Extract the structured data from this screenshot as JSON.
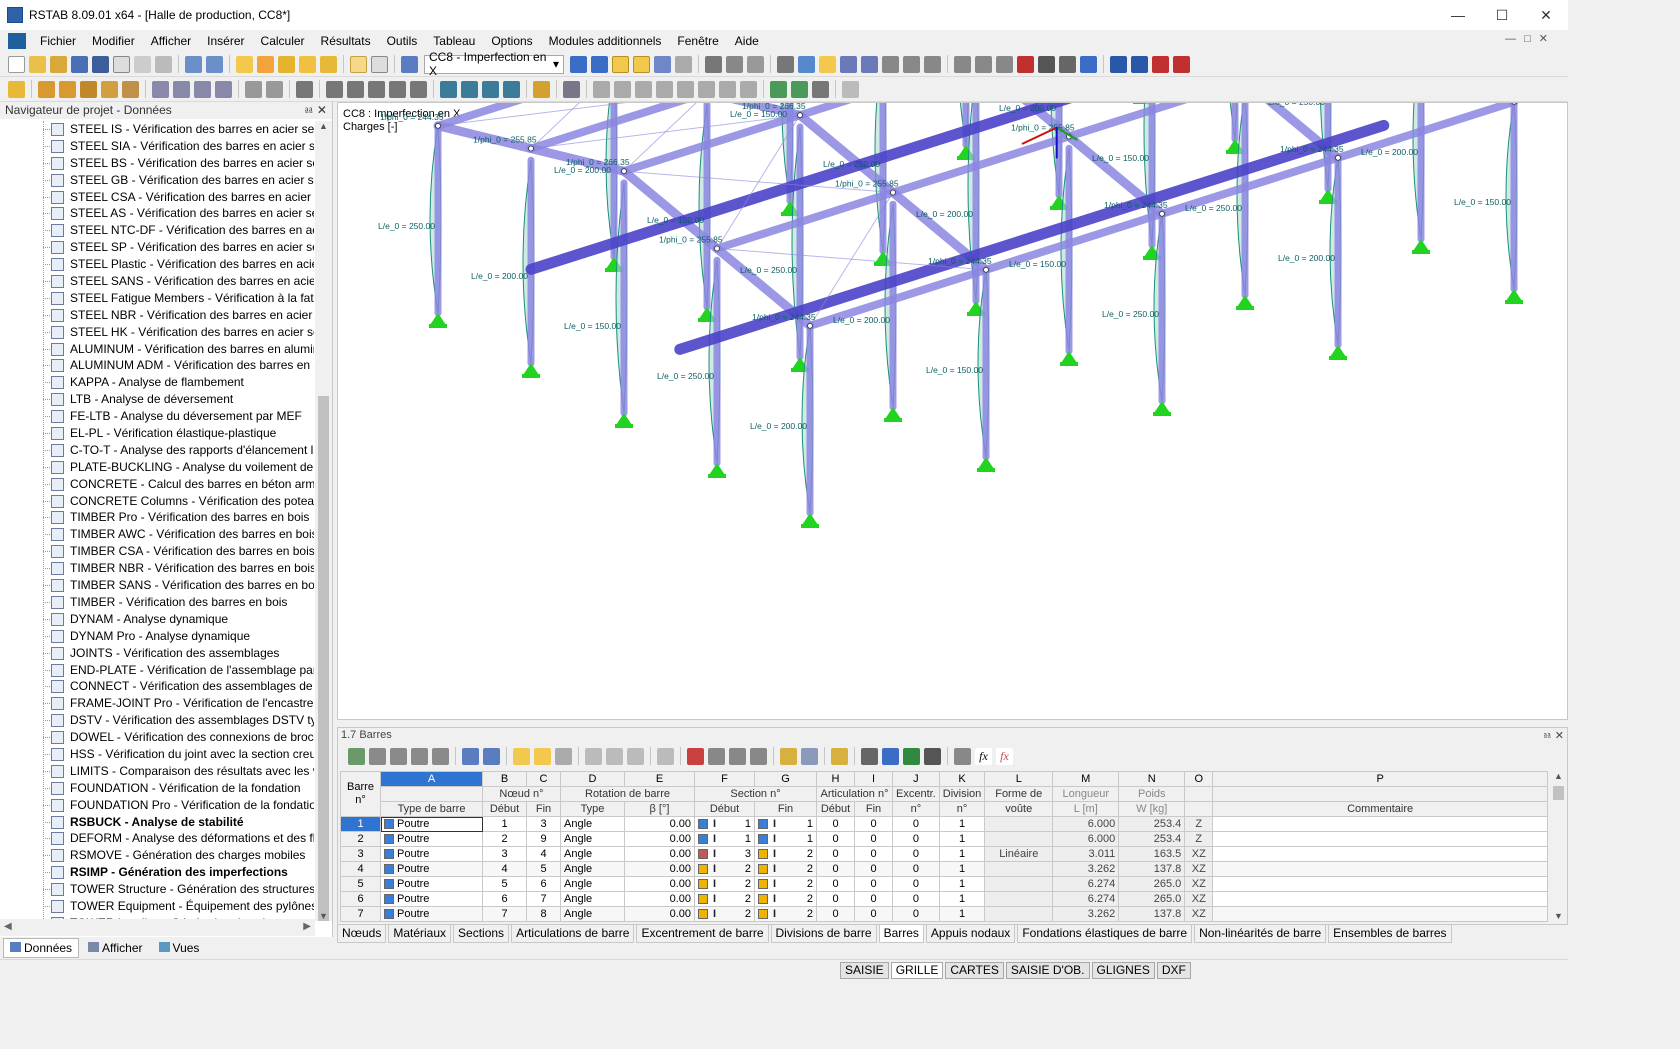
{
  "window": {
    "title": "RSTAB 8.09.01 x64 - [Halle de production, CC8*]"
  },
  "menu": [
    "Fichier",
    "Modifier",
    "Afficher",
    "Insérer",
    "Calculer",
    "Résultats",
    "Outils",
    "Tableau",
    "Options",
    "Modules additionnels",
    "Fenêtre",
    "Aide"
  ],
  "toolbar": {
    "loadcase": "CC8 - Imperfection en X"
  },
  "navigator": {
    "title": "Navigateur de projet - Données",
    "items": [
      {
        "label": "STEEL IS - Vérification des barres en acier selon IS"
      },
      {
        "label": "STEEL SIA - Vérification des barres en acier selon S"
      },
      {
        "label": "STEEL BS - Vérification des barres en acier selon B"
      },
      {
        "label": "STEEL GB - Vérification des barres en acier selon G"
      },
      {
        "label": "STEEL CSA - Vérification des barres en acier selon"
      },
      {
        "label": "STEEL AS - Vérification des barres en acier selon A"
      },
      {
        "label": "STEEL NTC-DF - Vérification des barres en acier se"
      },
      {
        "label": "STEEL SP - Vérification des barres en acier selon SI"
      },
      {
        "label": "STEEL Plastic - Vérification des barres en acier selc"
      },
      {
        "label": "STEEL SANS - Vérification des barres en acier selor"
      },
      {
        "label": "STEEL Fatigue Members - Vérification à la fatigue"
      },
      {
        "label": "STEEL NBR - Vérification des barres en acier selon"
      },
      {
        "label": "STEEL HK - Vérification des barres en acier selon H"
      },
      {
        "label": "ALUMINUM - Vérification des barres en aluminiu"
      },
      {
        "label": "ALUMINUM ADM - Vérification des barres en alur"
      },
      {
        "label": "KAPPA - Analyse de flambement"
      },
      {
        "label": "LTB - Analyse de déversement"
      },
      {
        "label": "FE-LTB - Analyse du déversement par MEF"
      },
      {
        "label": "EL-PL - Vérification élastique-plastique"
      },
      {
        "label": "C-TO-T - Analyse des rapports d'élancement limi"
      },
      {
        "label": "PLATE-BUCKLING - Analyse du voilement de plac"
      },
      {
        "label": "CONCRETE - Calcul des barres en béton armé"
      },
      {
        "label": "CONCRETE Columns - Vérification des poteaux er"
      },
      {
        "label": "TIMBER Pro - Vérification des barres en bois"
      },
      {
        "label": "TIMBER AWC - Vérification des barres en bois selc"
      },
      {
        "label": "TIMBER CSA - Vérification des barres en bois selo"
      },
      {
        "label": "TIMBER NBR - Vérification des barres en bois selo"
      },
      {
        "label": "TIMBER SANS - Vérification des barres en bois sel"
      },
      {
        "label": "TIMBER - Vérification des barres en bois"
      },
      {
        "label": "DYNAM - Analyse dynamique"
      },
      {
        "label": "DYNAM Pro - Analyse dynamique"
      },
      {
        "label": "JOINTS - Vérification des assemblages"
      },
      {
        "label": "END-PLATE - Vérification de l'assemblage par pla"
      },
      {
        "label": "CONNECT - Vérification des assemblages de cisai"
      },
      {
        "label": "FRAME-JOINT Pro - Vérification de l'encastremen"
      },
      {
        "label": "DSTV - Vérification des assemblages DSTV typiqu"
      },
      {
        "label": "DOWEL - Vérification des connexions de broche"
      },
      {
        "label": "HSS - Vérification du joint avec la section creuse"
      },
      {
        "label": "LIMITS - Comparaison des résultats avec les valeu"
      },
      {
        "label": "FOUNDATION - Vérification de la fondation"
      },
      {
        "label": "FOUNDATION Pro - Vérification de la fondation"
      },
      {
        "label": "RSBUCK - Analyse de stabilité",
        "bold": true
      },
      {
        "label": "DEFORM - Analyse des déformations et des flèche"
      },
      {
        "label": "RSMOVE - Génération des charges mobiles"
      },
      {
        "label": "RSIMP - Génération des imperfections",
        "bold": true
      },
      {
        "label": "TOWER Structure - Génération des structures pylô"
      },
      {
        "label": "TOWER Equipment - Équipement des pylônes en"
      },
      {
        "label": "TOWER Loading - Génération des charges"
      }
    ],
    "tabs": [
      "Données",
      "Afficher",
      "Vues"
    ]
  },
  "viewport": {
    "line1": "CC8 : Imperfection en X",
    "line2": "Charges [-]",
    "labels": [
      "1/phi_0 = 244.35",
      "1/phi_0 = 255.85",
      "1/phi_0 = 266.35",
      "L/e_0 = 250.00",
      "L/e_0 = 200.00",
      "L/e_0 = 150.00"
    ]
  },
  "table": {
    "title": "1.7 Barres",
    "letters": [
      "A",
      "B",
      "C",
      "D",
      "E",
      "F",
      "G",
      "H",
      "I",
      "J",
      "K",
      "L",
      "M",
      "N",
      "O",
      "P"
    ],
    "group_headers": {
      "barre": "Barre",
      "barre_n": "n°",
      "noeud": "Nœud n°",
      "rotation": "Rotation de barre",
      "section": "Section n°",
      "articulation": "Articulation n°",
      "excentr": "Excentr.",
      "division": "Division",
      "forme": "Forme de",
      "longueur": "Longueur",
      "poids": "Poids"
    },
    "sub_headers": {
      "type": "Type de barre",
      "debut": "Début",
      "fin": "Fin",
      "rtype": "Type",
      "beta": "β [°]",
      "sdebut": "Début",
      "sfin": "Fin",
      "adebut": "Début",
      "afin": "Fin",
      "exc_n": "n°",
      "div_n": "n°",
      "voute": "voûte",
      "len": "L [m]",
      "weight": "W [kg]",
      "comment": "Commentaire"
    },
    "rows": [
      {
        "n": "1",
        "type": "Poutre",
        "start": "1",
        "end": "3",
        "rot": "Angle",
        "beta": "0.00",
        "sec_s": "1",
        "sec_e": "1",
        "art_s": "0",
        "art_e": "0",
        "exc": "0",
        "div": "1",
        "forme": "",
        "len": "6.000",
        "w": "253.4",
        "dir": "Z",
        "c1": "#3a7ed8",
        "c2": "#3a7ed8"
      },
      {
        "n": "2",
        "type": "Poutre",
        "start": "2",
        "end": "9",
        "rot": "Angle",
        "beta": "0.00",
        "sec_s": "1",
        "sec_e": "1",
        "art_s": "0",
        "art_e": "0",
        "exc": "0",
        "div": "1",
        "forme": "",
        "len": "6.000",
        "w": "253.4",
        "dir": "Z",
        "c1": "#3a7ed8",
        "c2": "#3a7ed8"
      },
      {
        "n": "3",
        "type": "Poutre",
        "start": "3",
        "end": "4",
        "rot": "Angle",
        "beta": "0.00",
        "sec_s": "3",
        "sec_e": "2",
        "art_s": "0",
        "art_e": "0",
        "exc": "0",
        "div": "1",
        "forme": "Linéaire",
        "len": "3.011",
        "w": "163.5",
        "dir": "XZ",
        "c1": "#c05a5a",
        "c2": "#f0b400"
      },
      {
        "n": "4",
        "type": "Poutre",
        "start": "4",
        "end": "5",
        "rot": "Angle",
        "beta": "0.00",
        "sec_s": "2",
        "sec_e": "2",
        "art_s": "0",
        "art_e": "0",
        "exc": "0",
        "div": "1",
        "forme": "",
        "len": "3.262",
        "w": "137.8",
        "dir": "XZ",
        "c1": "#f0b400",
        "c2": "#f0b400"
      },
      {
        "n": "5",
        "type": "Poutre",
        "start": "5",
        "end": "6",
        "rot": "Angle",
        "beta": "0.00",
        "sec_s": "2",
        "sec_e": "2",
        "art_s": "0",
        "art_e": "0",
        "exc": "0",
        "div": "1",
        "forme": "",
        "len": "6.274",
        "w": "265.0",
        "dir": "XZ",
        "c1": "#f0b400",
        "c2": "#f0b400"
      },
      {
        "n": "6",
        "type": "Poutre",
        "start": "6",
        "end": "7",
        "rot": "Angle",
        "beta": "0.00",
        "sec_s": "2",
        "sec_e": "2",
        "art_s": "0",
        "art_e": "0",
        "exc": "0",
        "div": "1",
        "forme": "",
        "len": "6.274",
        "w": "265.0",
        "dir": "XZ",
        "c1": "#f0b400",
        "c2": "#f0b400"
      },
      {
        "n": "7",
        "type": "Poutre",
        "start": "7",
        "end": "8",
        "rot": "Angle",
        "beta": "0.00",
        "sec_s": "2",
        "sec_e": "2",
        "art_s": "0",
        "art_e": "0",
        "exc": "0",
        "div": "1",
        "forme": "",
        "len": "3.262",
        "w": "137.8",
        "dir": "XZ",
        "c1": "#f0b400",
        "c2": "#f0b400"
      }
    ],
    "tabs": [
      "Nœuds",
      "Matériaux",
      "Sections",
      "Articulations de barre",
      "Excentrement de barre",
      "Divisions de barre",
      "Barres",
      "Appuis nodaux",
      "Fondations élastiques de barre",
      "Non-linéarités de barre",
      "Ensembles de barres"
    ],
    "active_tab": "Barres"
  },
  "statusbar": {
    "buttons": [
      "SAISIE",
      "GRILLE",
      "CARTES",
      "SAISIE D'OB.",
      "GLIGNES",
      "DXF"
    ],
    "active": "GRILLE"
  },
  "colors": {
    "beam": "#8b86e0",
    "beam_dark": "#4a42c8",
    "support": "#22d322",
    "imperfection": "#1a8f7a",
    "selection": "#2f74d0"
  }
}
